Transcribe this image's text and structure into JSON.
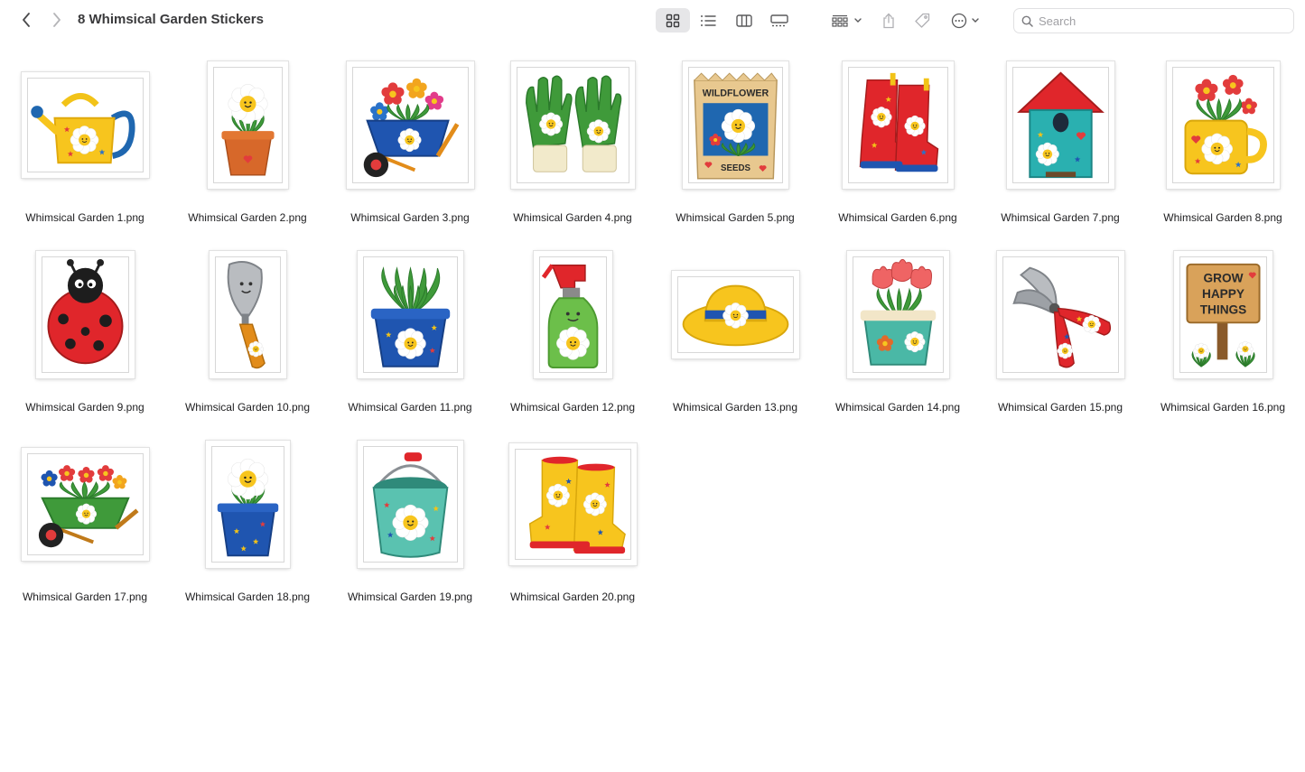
{
  "window": {
    "title": "8 Whimsical Garden Stickers"
  },
  "search": {
    "placeholder": "Search"
  },
  "files": [
    {
      "name": "Whimsical Garden 1.png",
      "icon": "watering-can"
    },
    {
      "name": "Whimsical Garden 2.png",
      "icon": "daisy-pot"
    },
    {
      "name": "Whimsical Garden 3.png",
      "icon": "wheelbarrow-flowers"
    },
    {
      "name": "Whimsical Garden 4.png",
      "icon": "garden-gloves"
    },
    {
      "name": "Whimsical Garden 5.png",
      "icon": "seed-packet",
      "text": [
        "WILDFLOWER",
        "SEEDS"
      ]
    },
    {
      "name": "Whimsical Garden 6.png",
      "icon": "red-boots"
    },
    {
      "name": "Whimsical Garden 7.png",
      "icon": "birdhouse"
    },
    {
      "name": "Whimsical Garden 8.png",
      "icon": "mug-flowers"
    },
    {
      "name": "Whimsical Garden 9.png",
      "icon": "ladybug"
    },
    {
      "name": "Whimsical Garden 10.png",
      "icon": "trowel"
    },
    {
      "name": "Whimsical Garden 11.png",
      "icon": "succulent-pot"
    },
    {
      "name": "Whimsical Garden 12.png",
      "icon": "spray-bottle"
    },
    {
      "name": "Whimsical Garden 13.png",
      "icon": "sun-hat"
    },
    {
      "name": "Whimsical Garden 14.png",
      "icon": "tulip-pot"
    },
    {
      "name": "Whimsical Garden 15.png",
      "icon": "pruners"
    },
    {
      "name": "Whimsical Garden 16.png",
      "icon": "grow-sign",
      "text": [
        "GROW",
        "HAPPY",
        "THINGS"
      ]
    },
    {
      "name": "Whimsical Garden 17.png",
      "icon": "green-wheelbarrow"
    },
    {
      "name": "Whimsical Garden 18.png",
      "icon": "daisy-blue-pot"
    },
    {
      "name": "Whimsical Garden 19.png",
      "icon": "bucket"
    },
    {
      "name": "Whimsical Garden 20.png",
      "icon": "yellow-boots"
    }
  ]
}
